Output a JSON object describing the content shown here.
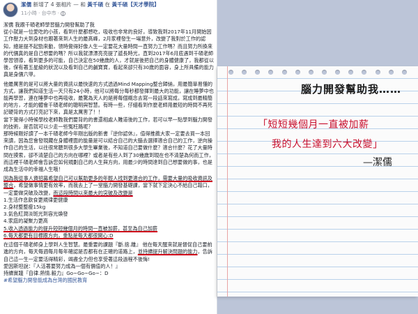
{
  "post": {
    "author": "潔儒",
    "action": "新增了 4 張相片 — 和",
    "place": "黃千碩",
    "at": "在",
    "page": "黃千碩【天才學院】",
    "time": "11小時 · 台中市 ·",
    "intro": "潔儒 我跟千碩老師學習腦力開發幫助了我",
    "p1": "從小就是一位愛吃的小孩，看到什麼都想吃，吸收也非常的良好，導致我到2017年11月開始因工作壓力大到身材也跟著來到人生的最高峰，2月家裡發生一場意外，改變了我對於工作的認知，總是提不起勁來動，領時覺得好像人生一定要花大量時間一直努力工作嗎？而且努力所換來的代價真的是自己想要的嗎？所以我就漂漂亮亮提了遞長時光，直到2017年6月底遇到千碩老師學習領導，看到更多的可能，自己決定在50幾歲的人，才就是後把自己的身體健康了，我都從以後，保有著五星級的狀況以及看到自己的鹹寶寶，看起來卻只有30歲的面容，身上所具備的能力真是身價六甲。",
    "p2": "他最厲害的是可以將大量的資訊以最快速的方式透過Mind Mapping整合歸納，用最簡單易懂的方式，讓我們知道生活一天只有24小時，他可以將每分每秒都發揮到最大的功能，讓在睡夢中也能再學習，連在睡夢中也再吸收，最驚為天人的是將每個概念去寫一段話來寫成，寫成到最精簡的地方，才能的體會千碩老師的聰明與智慧。有時一些，仔細看到作麼老師用最短的時間不再死記硬背的方式打亮記下來，真是太厲害了！！",
    "p3": "當下覺得小時候學校老師教我們要背的的書還相處人難道後的工作，若可以早一點學到腦力開發的技術，是否就可以少走一些冤枉路呢？",
    "p4": "那時候剛好讀了一本千碩老師今年剛出版的新書『逆你認休』，值得推薦大家一定要去買一本回來讀，因為您會發現藏在身體裡面的能量是可以結合自己的大腦去選擇適合自己的工作，逆向操作自己的生活，以往很常聽到很多大學生畢業後，不知道自己要做什麼？適合什麼？花了大量時間在摸索，卻不清楚自己的方向在哪裡？或者是有些人到了30幾歲到現在也不清楚為何而工作，而這裡千碩老師會告訴您如何規劃自己的人生與方向，用最少的時間達到自己想要做的事，也是成為生活中的幸福人生哦！",
    "p5_u1": "因為我從事人資招募希望自己可以幫助更多的年輕人找到更適合的工作，",
    "p5_u2": "需要大量的吸收資訊及整合",
    "p5_mid": "，希望做事情更有效率，而我去上了一堂腦力開發基礎課，當下就下定決心不給自己藉口，一定要做突破及改變，",
    "p5_u3": "而這段時間以來最大的突破及改變是",
    "list": [
      "1.生活作息飲食更規律更健康",
      "2.身材整整瘦15kg",
      "3.氣色紅潤淡斑光到容光煥發",
      "4.家中的收入來跟著提升，不需要再為錢的困擾與家庭難道可能，腦力開發後第一次收購經驗了！（努力中）",
      "4.家庭的凝聚力更高"
    ],
    "list_u1": "5.收入透過能力的提升短短幾個月的時間一直被加薪，甚至為自己加薪",
    "list_u2": "6.每天都更有目標跟方向，重點是每天都很開心:D",
    "p6": "在此真的很感謝千碩老師今天帶給我們一些人生體悟，每次講到就會激動不已，是一個多麼有影響力的人生導師，願我們有更多人一起學習腦力開發，這將會是我人生中的轉捩點。",
    "p7_start": "在這個千碩老師身上學到人生智慧。最重要的課題『斷.捨.離』",
    "p7_mid": "他在每天醒來就是督促自己要前進的方向，每天每週每月每年確認是否都有在正確的道路上，",
    "p7_u": "並持續提升解決問題的能力",
    "p7_end": "，告訴自己這一生一定要活得精彩，竭盡全力但也享受著這段過程不後悔!",
    "p8": "愛因斯坦說：『人活著要努力成為一個有價值的人！』",
    "p9": "持續實踐『自律.熱情.毅力』Go~Go~Go~：D",
    "hashtag": "#希望腦力開發能成為台灣的國民教育"
  },
  "note": {
    "title": "腦力開發幫助我……",
    "quote_line1": "「短短幾個月一直被加薪",
    "quote_line2": "我的人生達到六大改變」",
    "signature": "—潔儒"
  }
}
